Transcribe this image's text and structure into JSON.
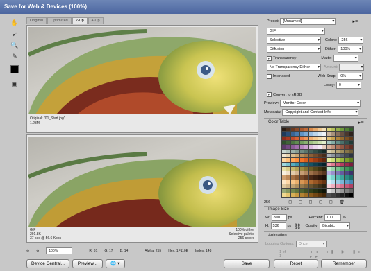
{
  "window": {
    "title": "Save for Web & Devices (100%)"
  },
  "tools": [
    {
      "name": "hand-tool-icon"
    },
    {
      "name": "slice-select-tool-icon"
    },
    {
      "name": "zoom-tool-icon"
    },
    {
      "name": "eyedropper-tool-icon"
    }
  ],
  "view_tabs": [
    "Original",
    "Optimized",
    "2-Up",
    "4-Up"
  ],
  "active_tab": "2-Up",
  "pane1": {
    "line1": "Original: \"01_Start.jpg\"",
    "line2": "1.23M"
  },
  "pane2": {
    "left1": "GIF",
    "left2": "291.8K",
    "left3": "37 sec @ 56.6 Kbps",
    "right1": "100% dither",
    "right2": "Selective palette",
    "right3": "256 colors"
  },
  "status": {
    "zoom": "100%",
    "r": "R: 31",
    "g": "G: 17",
    "b": "B: 14",
    "alpha": "Alpha: 255",
    "hex": "Hex: 1F110E",
    "index": "Index: 148"
  },
  "buttons": {
    "device_central": "Device Central...",
    "preview": "Preview...",
    "save": "Save",
    "reset": "Reset",
    "remember": "Remember"
  },
  "settings": {
    "preset_label": "Preset:",
    "preset_value": "[Unnamed]",
    "format": "GIF",
    "reduction": "Selective",
    "colors_label": "Colors:",
    "colors_value": "256",
    "dither_algo": "Diffusion",
    "dither_label": "Dither:",
    "dither_value": "100%",
    "transparency_label": "Transparency",
    "matte_label": "Matte:",
    "trans_dither": "No Transparency Dither",
    "amount_label": "Amount:",
    "interlaced_label": "Interlaced",
    "websnap_label": "Web Snap:",
    "websnap_value": "0%",
    "lossy_label": "Lossy:",
    "lossy_value": "0",
    "convert_label": "Convert to sRGB",
    "preview_label": "Preview:",
    "preview_value": "Monitor Color",
    "metadata_label": "Metadata:",
    "metadata_value": "Copyright and Contact Info"
  },
  "color_table": {
    "title": "Color Table",
    "count": "256",
    "colors": [
      "#2b1d14",
      "#4a2f1e",
      "#6b3b23",
      "#8c4a29",
      "#a85a2f",
      "#c06b39",
      "#d88a4a",
      "#e8a868",
      "#f0c890",
      "#f5e0b5",
      "#d9d37a",
      "#b7c15b",
      "#93b04a",
      "#6f9a3c",
      "#4f7f33",
      "#335f2a",
      "#1f3a5a",
      "#2c4e78",
      "#3a6594",
      "#4b7cae",
      "#6194c4",
      "#7daad4",
      "#9cc0e0",
      "#bcd6ea",
      "#d8e7f1",
      "#eef4f8",
      "#c9b5a0",
      "#a8927c",
      "#876f5c",
      "#674f41",
      "#4a372d",
      "#2f231d",
      "#8e2c1c",
      "#a93a22",
      "#c24b2b",
      "#d66235",
      "#e67b45",
      "#f09658",
      "#f5b070",
      "#f7c98c",
      "#f9dca8",
      "#fbeac5",
      "#e0c070",
      "#c9a24f",
      "#b0853b",
      "#96692d",
      "#7c5022",
      "#623b1a",
      "#30502d",
      "#3f6438",
      "#4f7844",
      "#618c51",
      "#749f60",
      "#89b170",
      "#9fc283",
      "#b6d298",
      "#cde1b0",
      "#e2efcb",
      "#a6c7c0",
      "#84aea6",
      "#648f88",
      "#4a716b",
      "#34554f",
      "#223b37",
      "#5d3a6a",
      "#744a82",
      "#8c5c98",
      "#a370ad",
      "#b887c0",
      "#cca0d1",
      "#ddbbe0",
      "#ecd7ee",
      "#f5eaf6",
      "#e8d0c0",
      "#d6b09a",
      "#c29078",
      "#ac725a",
      "#935743",
      "#7a4132",
      "#612f25",
      "#c9d6d0",
      "#b3c4bd",
      "#9db1a9",
      "#879d94",
      "#718980",
      "#5b756c",
      "#466159",
      "#334e47",
      "#223c36",
      "#142a26",
      "#d9cfb0",
      "#c7ba92",
      "#b3a376",
      "#9d8c5d",
      "#867448",
      "#6e5e37",
      "#f2e6d0",
      "#e7d3b0",
      "#d9bd90",
      "#c9a573",
      "#b78d5b",
      "#a27547",
      "#8b5f37",
      "#744b2b",
      "#5d3a22",
      "#472c1a",
      "#aab0b8",
      "#8d949e",
      "#727a85",
      "#59616d",
      "#424a56",
      "#2d3540",
      "#ffd7a0",
      "#ffc07a",
      "#ffa758",
      "#ff8e3c",
      "#f27429",
      "#d95e1e",
      "#bd4c17",
      "#9f3c12",
      "#80300e",
      "#62250b",
      "#e6f0a0",
      "#cfe07a",
      "#b5cd58",
      "#98b63d",
      "#7b9c2a",
      "#60801e",
      "#a0d8e0",
      "#7ac4d0",
      "#58adbf",
      "#3d95aa",
      "#2a7d93",
      "#1e667b",
      "#155264",
      "#0f404f",
      "#0a303c",
      "#06222b",
      "#f0a0b0",
      "#e07a92",
      "#cc5877",
      "#b43d60",
      "#992a4d",
      "#7d1e3d",
      "#e8e0a8",
      "#d8cc88",
      "#c6b66c",
      "#b19f54",
      "#9a8840",
      "#827130",
      "#6a5b23",
      "#534619",
      "#3e3411",
      "#2a230b",
      "#c0e8c8",
      "#98d8a8",
      "#74c48a",
      "#56ad70",
      "#3e945a",
      "#2c7a48",
      "#f8f0e0",
      "#f0e0c8",
      "#e4ccac",
      "#d6b590",
      "#c69e76",
      "#b3875f",
      "#9e714a",
      "#875c39",
      "#6f482a",
      "#57361e",
      "#b8b0e0",
      "#9a90cc",
      "#7e74b6",
      "#655b9e",
      "#4f4585",
      "#3b336b",
      "#d0a070",
      "#bc8858",
      "#a67144",
      "#8e5c34",
      "#764828",
      "#5f371e",
      "#4a2916",
      "#381e10",
      "#28150b",
      "#1a0e07",
      "#a0e8e0",
      "#7ad4cc",
      "#58bdb4",
      "#3da49b",
      "#2a8a82",
      "#1e706a",
      "#ffe8c8",
      "#ffd8a8",
      "#f5c488",
      "#e8ae6c",
      "#d89654",
      "#c57f40",
      "#b06a30",
      "#985624",
      "#80441a",
      "#683412",
      "#d8f0f8",
      "#b8e0f0",
      "#98cce4",
      "#7ab6d6",
      "#5e9fc6",
      "#4688b4",
      "#e0c8a0",
      "#d0b488",
      "#bea072",
      "#aa8c5e",
      "#94784c",
      "#7e653d",
      "#68532f",
      "#534224",
      "#3f321a",
      "#2c2312",
      "#f8d0d8",
      "#f0b0c0",
      "#e490a6",
      "#d6728e",
      "#c45878",
      "#ae4264",
      "#98a878",
      "#84965f",
      "#71844c",
      "#5f723c",
      "#4e602f",
      "#3f4f24",
      "#313f1b",
      "#253013",
      "#1a220d",
      "#101508",
      "#e0e0e0",
      "#c8c8c8",
      "#b0b0b0",
      "#989898",
      "#808080",
      "#686868",
      "#f0d890",
      "#e4c470",
      "#d6ae56",
      "#c69842",
      "#b38232",
      "#9e6d26",
      "#88591c",
      "#714614",
      "#5a360e",
      "#442809",
      "#505050",
      "#404040",
      "#303030",
      "#202020",
      "#101010",
      "#000000"
    ]
  },
  "image_size": {
    "title": "Image Size",
    "w_label": "W:",
    "w_value": "800",
    "w_unit": "px",
    "h_label": "H:",
    "h_value": "536",
    "h_unit": "px",
    "percent_label": "Percent:",
    "percent_value": "100",
    "percent_unit": "%",
    "quality_label": "Quality:",
    "quality_value": "Bicubic"
  },
  "animation": {
    "title": "Animation",
    "looping_label": "Looping Options:",
    "looping_value": "Once",
    "frame": "1 of 1"
  }
}
